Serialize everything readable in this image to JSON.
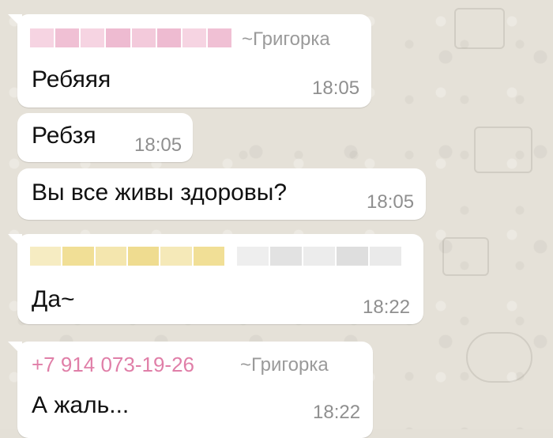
{
  "chat": {
    "messages": [
      {
        "sender_name": "~Григорка",
        "text": "Ребяяя",
        "time": "18:05"
      },
      {
        "text": "Ребзя",
        "time": "18:05"
      },
      {
        "text": "Вы все живы здоровы?",
        "time": "18:05"
      },
      {
        "text": "Да~",
        "time": "18:22"
      },
      {
        "sender_phone": "+7 914 073-19-26",
        "sender_name": "~Григорка",
        "text": "А жаль...",
        "time": "18:22"
      }
    ]
  },
  "colors": {
    "sender_phone": "#e07fa8",
    "blurred_name_pink": "#f3c2d6",
    "blurred_name_yellow": "#f2e2a0",
    "bubble": "#ffffff",
    "wallpaper": "#e5e1d8"
  }
}
